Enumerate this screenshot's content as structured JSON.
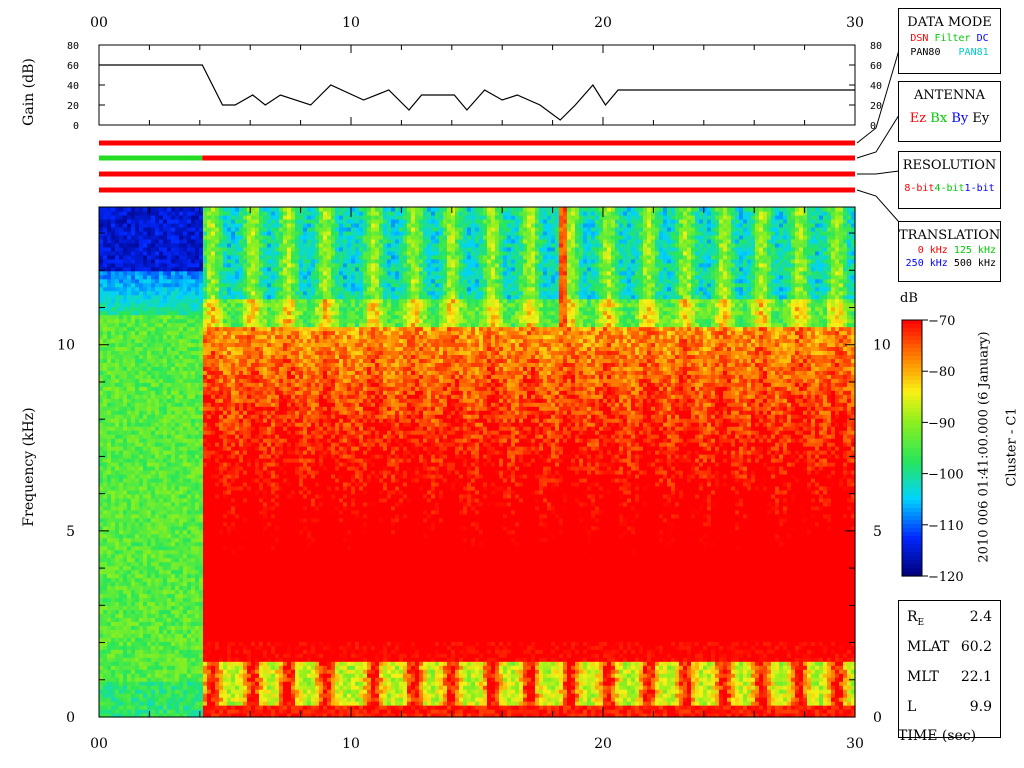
{
  "legend": {
    "data_mode": {
      "title": "DATA MODE",
      "items": [
        {
          "label": "DSN",
          "color": "#ff0000"
        },
        {
          "label": "Filter",
          "color": "#00cc00"
        },
        {
          "label": "DC",
          "color": "#0000ff"
        },
        {
          "label": "PAN80",
          "color": "#000000"
        },
        {
          "label": "PAN81",
          "color": "#00cccc"
        }
      ]
    },
    "antenna": {
      "title": "ANTENNA",
      "items": [
        {
          "label": "Ez",
          "color": "#ff0000"
        },
        {
          "label": "Bx",
          "color": "#00cc00"
        },
        {
          "label": "By",
          "color": "#0000ff"
        },
        {
          "label": "Ey",
          "color": "#000000"
        }
      ]
    },
    "resolution": {
      "title": "RESOLUTION",
      "items": [
        {
          "label": "8-bit",
          "color": "#ff0000"
        },
        {
          "label": "4-bit",
          "color": "#00cc00"
        },
        {
          "label": "1-bit",
          "color": "#0000ff"
        }
      ]
    },
    "translation": {
      "title": "TRANSLATION",
      "items": [
        {
          "label": "0 kHz",
          "color": "#ff0000"
        },
        {
          "label": "125 kHz",
          "color": "#00cc00"
        },
        {
          "label": "250 kHz",
          "color": "#0000ff"
        },
        {
          "label": "500 kHz",
          "color": "#000000"
        }
      ]
    }
  },
  "ephemeris": [
    {
      "label": "RE",
      "value": "2.4"
    },
    {
      "label": "MLAT",
      "value": "60.2"
    },
    {
      "label": "MLT",
      "value": "22.1"
    },
    {
      "label": "L",
      "value": "9.9"
    }
  ],
  "annotation": {
    "time": "2010 006 01:41:00.000 (6 January)",
    "spacecraft": "Cluster - C1"
  },
  "chart_data": [
    {
      "type": "line",
      "ylabel": "Gain (dB)",
      "xlim": [
        0,
        30
      ],
      "ylim": [
        0,
        80
      ],
      "x_ticks": [
        "00",
        "10",
        "20",
        "30"
      ],
      "y_ticks": [
        "0",
        "20",
        "40",
        "60",
        "80"
      ],
      "x": [
        0,
        4.1,
        4.5,
        4.9,
        5.4,
        6.1,
        6.6,
        7.2,
        8.4,
        9.2,
        10.5,
        11.5,
        12.3,
        12.8,
        14.1,
        14.6,
        15.3,
        16.0,
        16.6,
        17.5,
        18.3,
        18.9,
        19.6,
        20.1,
        20.6,
        30
      ],
      "values": [
        60,
        60,
        40,
        20,
        20,
        30,
        20,
        30,
        20,
        40,
        25,
        35,
        15,
        30,
        30,
        15,
        35,
        25,
        30,
        20,
        5,
        20,
        40,
        20,
        35,
        35
      ]
    },
    {
      "type": "heatmap",
      "name": "data-mode-bars",
      "tracks": [
        {
          "segments": [
            {
              "from": 0,
              "to": 30,
              "color": "#ff0000"
            }
          ]
        },
        {
          "segments": [
            {
              "from": 0,
              "to": 4.1,
              "color": "#22dd22"
            },
            {
              "from": 4.1,
              "to": 30,
              "color": "#ff0000"
            }
          ]
        },
        {
          "segments": [
            {
              "from": 0,
              "to": 30,
              "color": "#ff0000"
            }
          ]
        },
        {
          "segments": [
            {
              "from": 0,
              "to": 30,
              "color": "#ff0000"
            }
          ]
        }
      ]
    },
    {
      "type": "heatmap",
      "xlabel": "TIME (sec)",
      "ylabel": "Frequency (kHz)",
      "xlim": [
        0,
        30
      ],
      "ylim": [
        0,
        13.7
      ],
      "x_ticks": [
        "00",
        "10",
        "20",
        "30"
      ],
      "y_ticks": [
        "0",
        "5",
        "10"
      ],
      "colorbar": {
        "unit": "dB",
        "range": [
          -120,
          -70
        ],
        "ticks": [
          "-70",
          "-80",
          "-90",
          "-100",
          "-110",
          "-120"
        ]
      },
      "quiet_interval": [
        0,
        4.1
      ],
      "upper_band_cutoff_khz": 10.5,
      "low_band_khz": [
        0.3,
        1.5
      ],
      "burst_times": [
        4.5,
        6.1,
        7.5,
        9.0,
        10.9,
        12.5,
        14.0,
        15.6,
        17.1,
        18.7,
        20.2,
        21.8,
        23.3,
        24.8,
        26.3,
        27.8,
        29.3
      ],
      "spectral_line_time": 18.4
    }
  ]
}
